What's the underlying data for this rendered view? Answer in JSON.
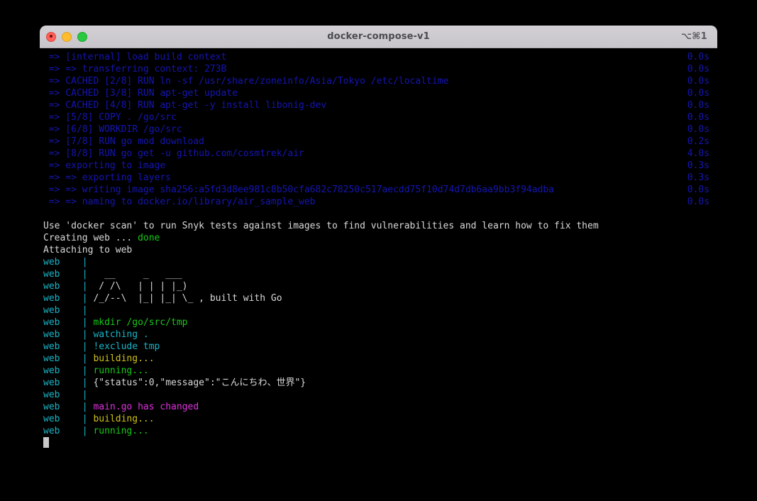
{
  "window": {
    "title": "docker-compose-v1",
    "shortcut": "⌥⌘1",
    "traffic_lights": {
      "close": "close-button",
      "minimize": "minimize-button",
      "maximize": "maximize-button"
    }
  },
  "colors": {
    "background": "#000000",
    "titlebar": "#c8c6cb",
    "blue": "#1515b5",
    "white": "#d9d9d9",
    "green": "#19c819",
    "cyan": "#18b6c8",
    "yellow": "#cfc21a",
    "magenta": "#e030e0",
    "cursor": "#c9c9c9"
  },
  "build_output": [
    {
      "text": " => [internal] load build context",
      "time": "0.0s"
    },
    {
      "text": " => => transferring context: 273B",
      "time": "0.0s"
    },
    {
      "text": " => CACHED [2/8] RUN ln -sf /usr/share/zoneinfo/Asia/Tokyo /etc/localtime",
      "time": "0.0s"
    },
    {
      "text": " => CACHED [3/8] RUN apt-get update",
      "time": "0.0s"
    },
    {
      "text": " => CACHED [4/8] RUN apt-get -y install libonig-dev",
      "time": "0.0s"
    },
    {
      "text": " => [5/8] COPY . /go/src",
      "time": "0.0s"
    },
    {
      "text": " => [6/8] WORKDIR /go/src",
      "time": "0.0s"
    },
    {
      "text": " => [7/8] RUN go mod download",
      "time": "0.2s"
    },
    {
      "text": " => [8/8] RUN go get -u github.com/cosmtrek/air",
      "time": "4.0s"
    },
    {
      "text": " => exporting to image",
      "time": "0.3s"
    },
    {
      "text": " => => exporting layers",
      "time": "0.3s"
    },
    {
      "text": " => => writing image sha256:a5fd3d8ee981c8b50cfa682c78250c517aecdd75f10d74d7db6aa9bb3f94adba",
      "time": "0.0s"
    },
    {
      "text": " => => naming to docker.io/library/air_sample_web",
      "time": "0.0s"
    }
  ],
  "scan_notice": "Use 'docker scan' to run Snyk tests against images to find vulnerabilities and learn how to fix them",
  "creating": {
    "prefix": "Creating web ... ",
    "status": "done"
  },
  "attaching": "Attaching to web",
  "log_prefix": "web",
  "log_separator": "|",
  "log_lines": [
    {
      "text": "",
      "color": "cyan"
    },
    {
      "text": "  __     _   ___",
      "color": "white"
    },
    {
      "text": " / /\\   | | | |_)",
      "color": "white"
    },
    {
      "text": "/_/--\\  |_| |_| \\_ , built with Go",
      "color": "white"
    },
    {
      "text": "",
      "color": "cyan"
    },
    {
      "text": "mkdir /go/src/tmp",
      "color": "green"
    },
    {
      "text": "watching .",
      "color": "cyan"
    },
    {
      "text": "!exclude tmp",
      "color": "cyan"
    },
    {
      "text": "building...",
      "color": "yellow"
    },
    {
      "text": "running...",
      "color": "green"
    },
    {
      "text": "{\"status\":0,\"message\":\"こんにちわ、世界\"}",
      "color": "white"
    },
    {
      "text": "",
      "color": "cyan"
    },
    {
      "text": "main.go has changed",
      "color": "magenta"
    },
    {
      "text": "building...",
      "color": "yellow"
    },
    {
      "text": "running...",
      "color": "green"
    }
  ]
}
